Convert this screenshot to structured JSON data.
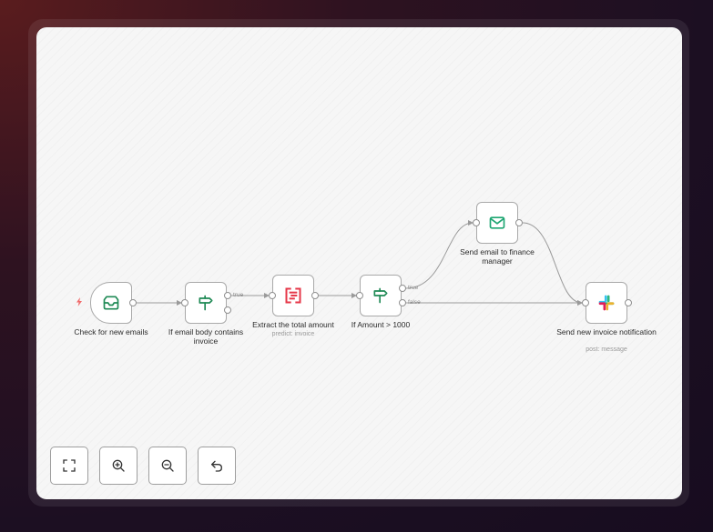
{
  "workflow": {
    "nodes": [
      {
        "id": "n1",
        "name": "Check for new emails",
        "subtitle": "",
        "icon": "inbox-icon"
      },
      {
        "id": "n2",
        "name": "If email body contains invoice",
        "subtitle": "",
        "icon": "signpost-icon"
      },
      {
        "id": "n3",
        "name": "Extract the total amount",
        "subtitle": "predict: invoice",
        "icon": "document-extract-icon"
      },
      {
        "id": "n4",
        "name": "If Amount > 1000",
        "subtitle": "",
        "icon": "signpost-icon"
      },
      {
        "id": "n5",
        "name": "Send email to finance manager",
        "subtitle": "",
        "icon": "mail-icon"
      },
      {
        "id": "n6",
        "name": "Send new invoice notification",
        "subtitle": "post: message",
        "icon": "slack-icon"
      }
    ],
    "edge_labels": {
      "n2_true": "true",
      "n4_true": "true",
      "n4_false": "false"
    },
    "trigger_icon": "lightning-bolt-icon"
  },
  "controls": {
    "fit_view": "fit-view-icon",
    "zoom_in": "zoom-in-icon",
    "zoom_out": "zoom-out-icon",
    "undo": "undo-icon"
  },
  "colors": {
    "branch_green": "#1f8a55",
    "extract_red": "#e6384a",
    "mail_green": "#1ea672",
    "trigger_bolt": "#f06a6a",
    "edge_gray": "#9a9a9a"
  }
}
